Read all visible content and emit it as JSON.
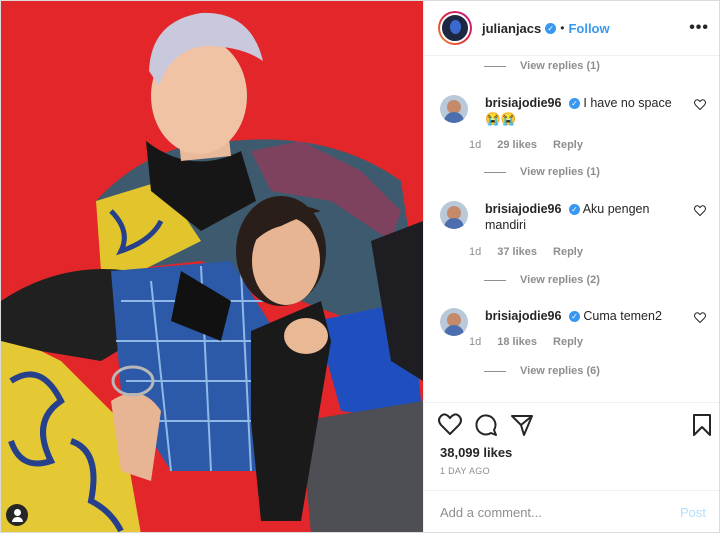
{
  "header": {
    "username": "julianjacs",
    "follow_label": "Follow",
    "separator": "•",
    "more_icon": "more-options-icon"
  },
  "photo": {
    "tag_icon": "user-tag-icon"
  },
  "comments": {
    "top_view_replies": "View replies (1)",
    "items": [
      {
        "user": "brisiajodie96",
        "text": "I have no space",
        "emoji": "😭😭",
        "time": "1d",
        "likes": "29 likes",
        "reply": "Reply",
        "view_replies": "View replies (1)"
      },
      {
        "user": "brisiajodie96",
        "text": "Aku pengen mandiri",
        "emoji": "",
        "time": "1d",
        "likes": "37 likes",
        "reply": "Reply",
        "view_replies": "View replies (2)"
      },
      {
        "user": "brisiajodie96",
        "text": "Cuma temen2",
        "emoji": "",
        "time": "1d",
        "likes": "18 likes",
        "reply": "Reply",
        "view_replies": "View replies (6)"
      }
    ]
  },
  "actions": {
    "likes": "38,099 likes",
    "ago": "1 DAY AGO"
  },
  "compose": {
    "placeholder": "Add a comment...",
    "post_label": "Post"
  },
  "colors": {
    "background_red": "#e2262a",
    "link_blue": "#3897f0",
    "muted": "#8e8e8e"
  }
}
